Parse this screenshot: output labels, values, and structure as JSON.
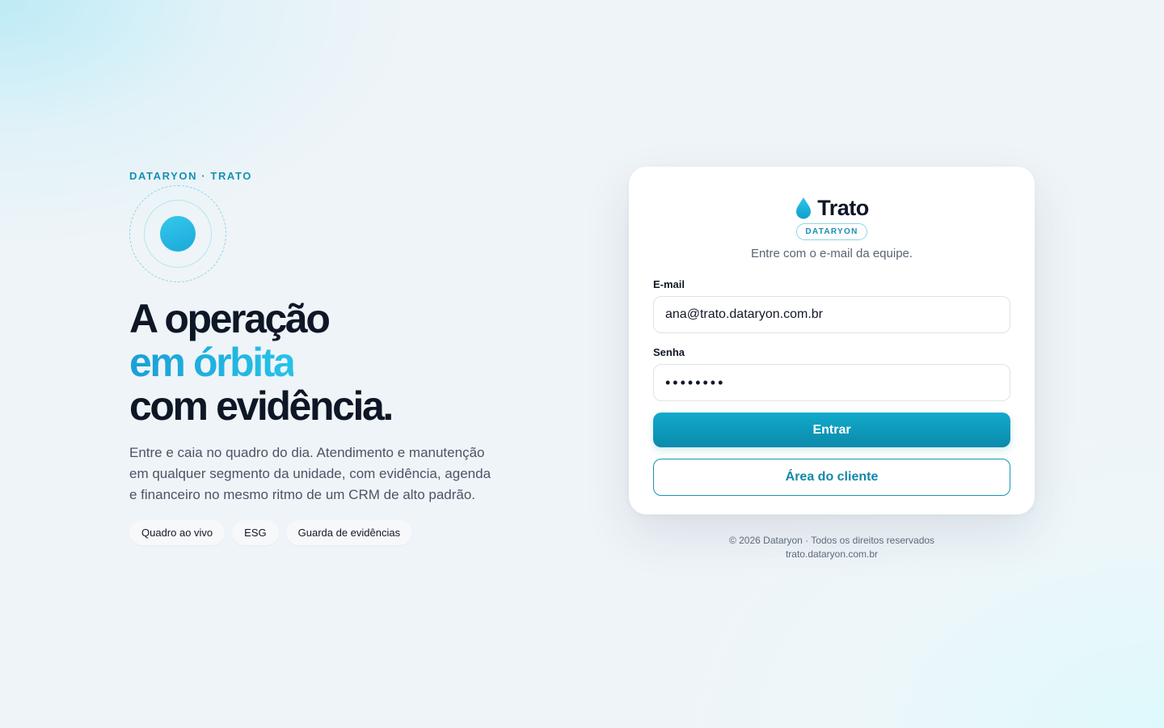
{
  "hero": {
    "eyebrow": "DATARYON · TRATO",
    "headline_line1": "A operação",
    "headline_line2": "em órbita",
    "headline_line3": "com evidência.",
    "lead": "Entre e caia no quadro do dia. Atendimento e manutenção em qualquer segmento da unidade, com evidência, agenda e financeiro no mesmo ritmo de um CRM de alto padrão.",
    "chips": [
      "Quadro ao vivo",
      "ESG",
      "Guarda de evidências"
    ]
  },
  "login": {
    "brand_icon": "water-drop-icon",
    "brand_name": "Trato",
    "badge": "DATARYON",
    "subtitle": "Entre com o e-mail da equipe.",
    "email_label": "E-mail",
    "email_value": "ana@trato.dataryon.com.br",
    "password_label": "Senha",
    "password_value": "trato123",
    "submit_label": "Entrar",
    "client_area_label": "Área do cliente"
  },
  "footer": {
    "copyright": "© 2026 Dataryon · Todos os direitos reservados",
    "domain": "trato.dataryon.com.br"
  },
  "colors": {
    "accent": "#1590b3",
    "primary_button": "#0a8aab",
    "headline": "#0e1726"
  }
}
